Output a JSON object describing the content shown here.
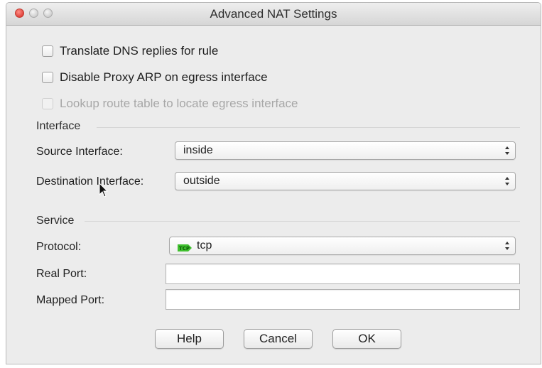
{
  "window": {
    "title": "Advanced NAT Settings"
  },
  "options": {
    "translate_dns": {
      "label": "Translate DNS replies for rule",
      "checked": false
    },
    "disable_proxy_arp": {
      "label": "Disable Proxy ARP on egress interface",
      "checked": false
    },
    "lookup_route": {
      "label": "Lookup route table to locate egress interface",
      "checked": false,
      "disabled": true
    }
  },
  "interface": {
    "section_title": "Interface",
    "source_label": "Source Interface:",
    "source_value": "inside",
    "destination_label": "Destination Interface:",
    "destination_value": "outside"
  },
  "service": {
    "section_title": "Service",
    "protocol_label": "Protocol:",
    "protocol_value": "tcp",
    "protocol_icon": "tcp-protocol-icon",
    "real_port_label": "Real Port:",
    "real_port_value": "",
    "mapped_port_label": "Mapped Port:",
    "mapped_port_value": ""
  },
  "buttons": {
    "help": "Help",
    "cancel": "Cancel",
    "ok": "OK"
  },
  "colors": {
    "window_bg": "#ececec",
    "close_light": "#e0443e",
    "tcp_icon": "#3fbf2e"
  }
}
